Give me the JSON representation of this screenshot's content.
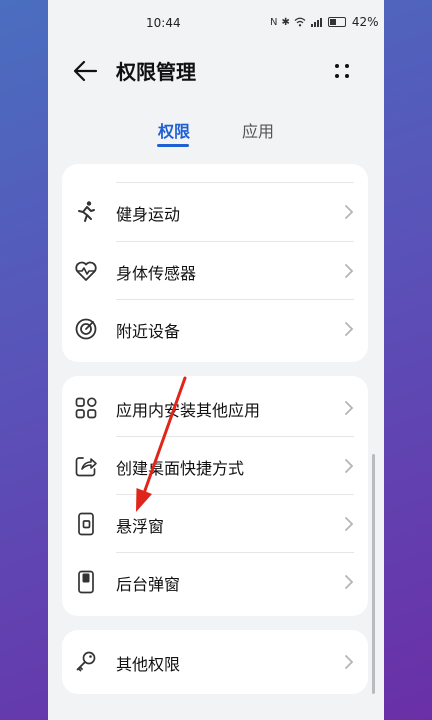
{
  "status_bar": {
    "time": "10:44",
    "icons": [
      "nfc-icon",
      "bluetooth-icon",
      "wifi-icon",
      "signal-icon",
      "battery-icon"
    ],
    "battery": "42%"
  },
  "header": {
    "title": "权限管理",
    "back_icon": "arrow-left-icon",
    "more_icon": "more-dots-icon"
  },
  "tabs": [
    {
      "label": "权限",
      "active": true
    },
    {
      "label": "应用",
      "active": false
    }
  ],
  "groups": [
    {
      "items": [
        {
          "label": "健身运动",
          "icon": "running-icon"
        },
        {
          "label": "身体传感器",
          "icon": "heart-pulse-icon"
        },
        {
          "label": "附近设备",
          "icon": "radar-target-icon"
        }
      ]
    },
    {
      "items": [
        {
          "label": "应用内安装其他应用",
          "icon": "app-grid-icon"
        },
        {
          "label": "创建桌面快捷方式",
          "icon": "shortcut-share-icon"
        },
        {
          "label": "悬浮窗",
          "icon": "floating-window-icon"
        },
        {
          "label": "后台弹窗",
          "icon": "background-popup-icon"
        }
      ]
    },
    {
      "items": [
        {
          "label": "其他权限",
          "icon": "key-icon"
        }
      ]
    }
  ],
  "colors": {
    "accent": "#1f5fd6",
    "annotation_arrow": "#e0251b",
    "background": "#f1f3f5"
  }
}
